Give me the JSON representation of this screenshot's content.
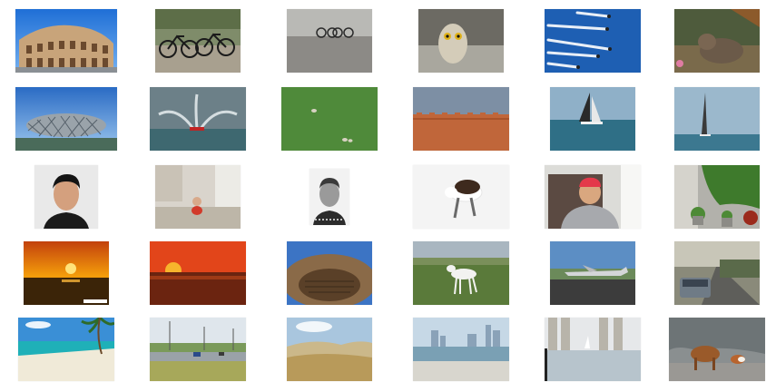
{
  "gallery": {
    "rows": 5,
    "columns": 6,
    "thumbnails": [
      {
        "subject": "colosseum-exterior"
      },
      {
        "subject": "bicycles-on-path"
      },
      {
        "subject": "bicycles-by-wall"
      },
      {
        "subject": "owl"
      },
      {
        "subject": "jets-in-formation"
      },
      {
        "subject": "dog-on-mat"
      },
      {
        "subject": "birds-nest-stadium"
      },
      {
        "subject": "fireboat-fountain"
      },
      {
        "subject": "birds-on-grass"
      },
      {
        "subject": "red-brick-wall"
      },
      {
        "subject": "sailboat-racing"
      },
      {
        "subject": "sailboat-distant"
      },
      {
        "subject": "man-portrait"
      },
      {
        "subject": "baby-in-room"
      },
      {
        "subject": "boy-portrait"
      },
      {
        "subject": "dog-in-snow"
      },
      {
        "subject": "boy-in-chair"
      },
      {
        "subject": "potted-plants"
      },
      {
        "subject": "sunset-ocean"
      },
      {
        "subject": "sunset-red-sky"
      },
      {
        "subject": "colosseum-interior"
      },
      {
        "subject": "greyhound-in-field"
      },
      {
        "subject": "jet-on-airfield"
      },
      {
        "subject": "car-on-road"
      },
      {
        "subject": "tropical-beach"
      },
      {
        "subject": "cars-on-highway"
      },
      {
        "subject": "desert-dunes"
      },
      {
        "subject": "city-skyline-shore"
      },
      {
        "subject": "pillars-by-water"
      },
      {
        "subject": "cows-on-road"
      }
    ]
  }
}
